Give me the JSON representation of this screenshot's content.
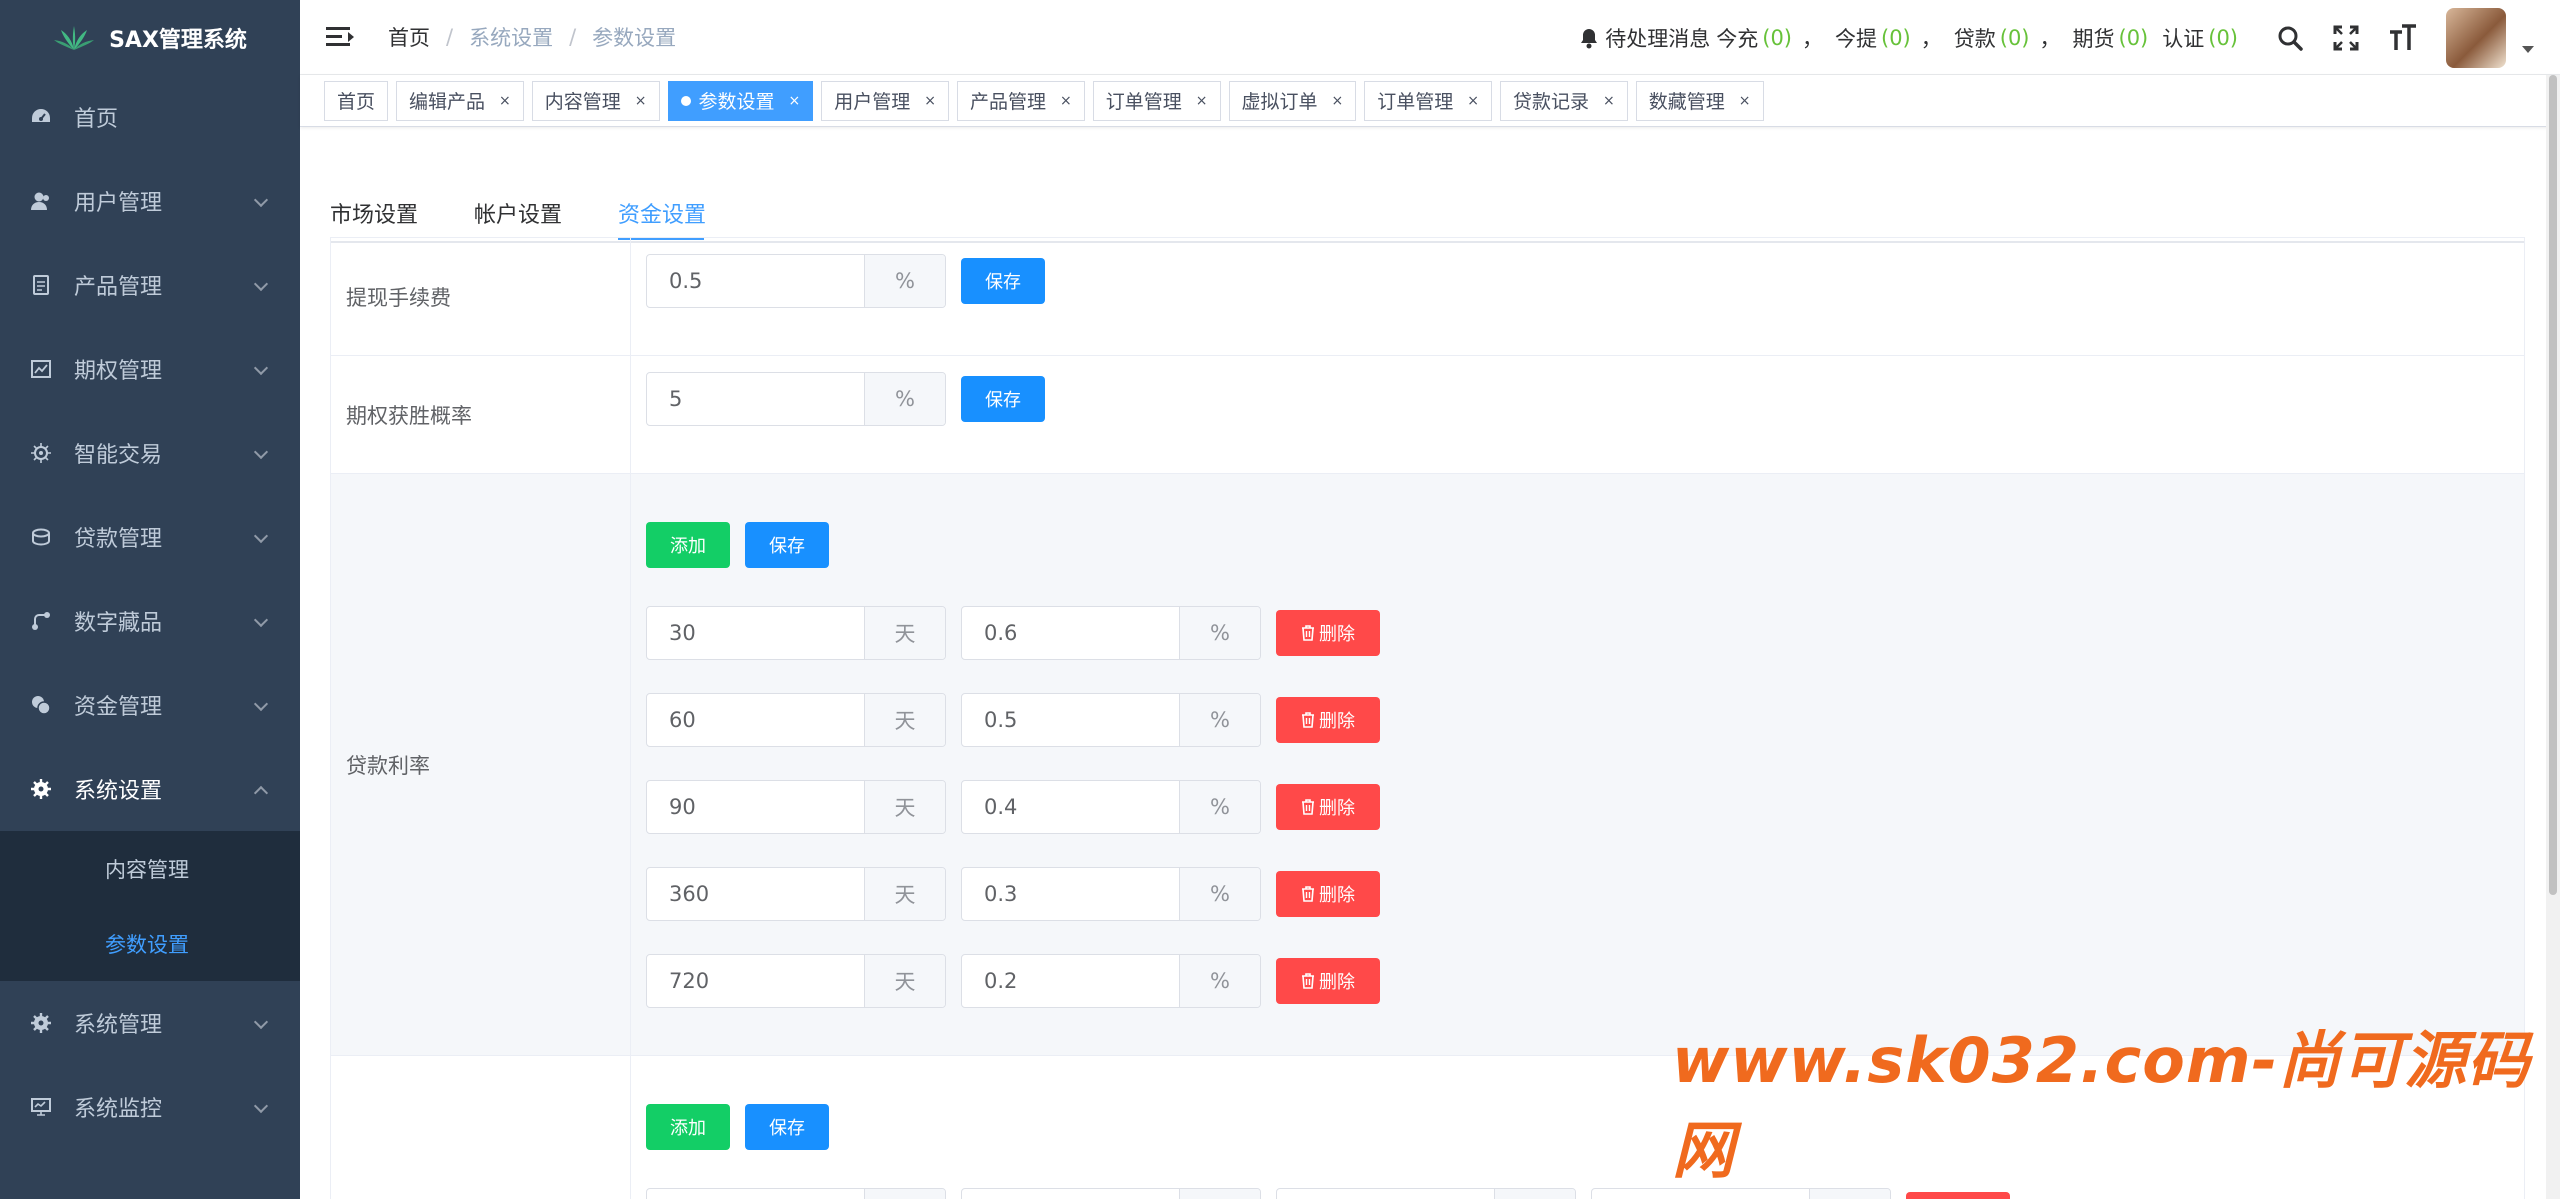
{
  "app": {
    "title": "SAX管理系统"
  },
  "sidebar": {
    "items": [
      {
        "label": "首页",
        "icon": "dashboard-icon"
      },
      {
        "label": "用户管理",
        "icon": "user-icon"
      },
      {
        "label": "产品管理",
        "icon": "document-icon"
      },
      {
        "label": "期权管理",
        "icon": "chart-icon"
      },
      {
        "label": "智能交易",
        "icon": "gear-icon"
      },
      {
        "label": "贷款管理",
        "icon": "money-icon"
      },
      {
        "label": "数字藏品",
        "icon": "link-icon"
      },
      {
        "label": "资金管理",
        "icon": "coins-icon"
      },
      {
        "label": "系统设置",
        "icon": "gear-icon"
      },
      {
        "label": "系统管理",
        "icon": "gear-icon"
      },
      {
        "label": "系统监控",
        "icon": "monitor-icon"
      }
    ],
    "submenu": [
      {
        "label": "内容管理"
      },
      {
        "label": "参数设置"
      }
    ]
  },
  "breadcrumb": [
    "首页",
    "系统设置",
    "参数设置"
  ],
  "notice": {
    "title": "待处理消息",
    "items": [
      {
        "label": "今充",
        "count": "(0)"
      },
      {
        "label": "今提",
        "count": "(0)"
      },
      {
        "label": "贷款",
        "count": "(0)"
      },
      {
        "label": "期货",
        "count": "(0)"
      },
      {
        "label": "认证",
        "count": "(0)"
      }
    ],
    "separator": "，"
  },
  "tags": [
    "首页",
    "编辑产品",
    "内容管理",
    "参数设置",
    "用户管理",
    "产品管理",
    "订单管理",
    "虚拟订单",
    "订单管理",
    "贷款记录",
    "数藏管理"
  ],
  "tag_close": "×",
  "tabs": [
    "市场设置",
    "帐户设置",
    "资金设置"
  ],
  "settings": {
    "withdraw_fee": {
      "label": "提现手续费",
      "value": "0.5",
      "unit": "%"
    },
    "option_win_rate": {
      "label": "期权获胜概率",
      "value": "5",
      "unit": "%"
    },
    "loan_rate": {
      "label": "贷款利率",
      "rows": [
        {
          "days": "30",
          "day_unit": "天",
          "rate": "0.6",
          "rate_unit": "%"
        },
        {
          "days": "60",
          "day_unit": "天",
          "rate": "0.5",
          "rate_unit": "%"
        },
        {
          "days": "90",
          "day_unit": "天",
          "rate": "0.4",
          "rate_unit": "%"
        },
        {
          "days": "360",
          "day_unit": "天",
          "rate": "0.3",
          "rate_unit": "%"
        },
        {
          "days": "720",
          "day_unit": "天",
          "rate": "0.2",
          "rate_unit": "%"
        }
      ]
    }
  },
  "buttons": {
    "save": "保存",
    "add": "添加",
    "delete": "删除"
  },
  "watermark": "www.sk032.com-尚可源码网",
  "colors": {
    "sidebar": "#304156",
    "primary": "#1890ff",
    "success": "#13ce66",
    "danger": "#ff4949",
    "active_link": "#409eff"
  }
}
